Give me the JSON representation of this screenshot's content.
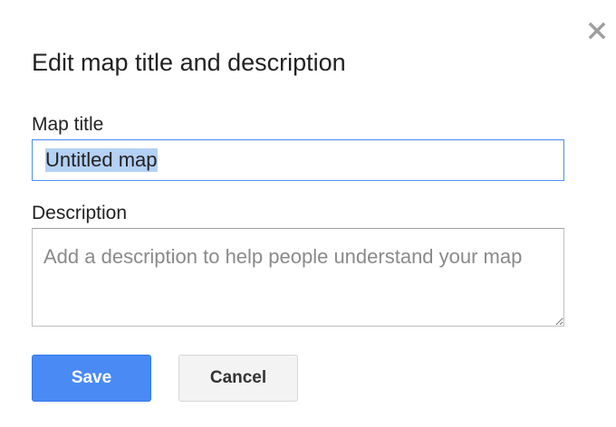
{
  "dialog": {
    "title": "Edit map title and description",
    "close_icon": "close-icon"
  },
  "form": {
    "map_title_label": "Map title",
    "map_title_value": "Untitled map",
    "description_label": "Description",
    "description_value": "",
    "description_placeholder": "Add a description to help people understand your map"
  },
  "buttons": {
    "save_label": "Save",
    "cancel_label": "Cancel"
  },
  "colors": {
    "save_button": "#4a8af4",
    "focus_border": "#4d90fe",
    "selection_highlight": "#b4d0f5"
  }
}
